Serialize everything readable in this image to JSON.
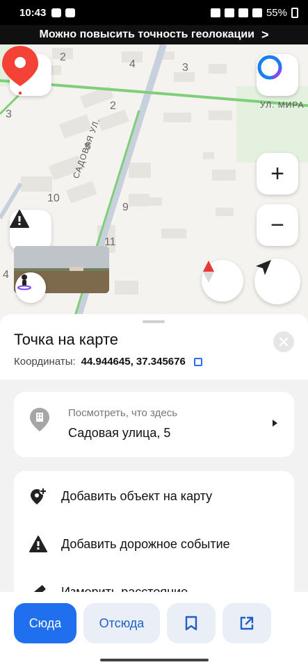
{
  "status_bar": {
    "time": "10:43",
    "battery": "55%"
  },
  "banner": {
    "text": "Можно повысить точность геолокации",
    "chevron": ">"
  },
  "map": {
    "house_numbers": [
      "2",
      "4",
      "3",
      "3",
      "2",
      "6",
      "10",
      "9",
      "11",
      "4"
    ],
    "street_sadovaya": "САДОВАЯ УЛ.",
    "street_mira": "УЛ. МИРА",
    "zoom_in_label": "+",
    "zoom_out_label": "−",
    "colors": {
      "pin": "#f44336",
      "road": "#c7d0dc",
      "green_road": "#7fcf7a",
      "compass_red": "#e53935"
    }
  },
  "sheet": {
    "title": "Точка на карте",
    "coords_label": "Координаты:",
    "coords_value": "44.944645, 37.345676",
    "what_here": {
      "subtitle": "Посмотреть, что здесь",
      "address": "Садовая улица, 5"
    },
    "actions": [
      {
        "label": "Добавить объект на карту",
        "icon": "add-place-icon"
      },
      {
        "label": "Добавить дорожное событие",
        "icon": "warning-icon"
      },
      {
        "label": "Измерить расстояние",
        "icon": "ruler-icon"
      }
    ]
  },
  "bottom_bar": {
    "here_label": "Сюда",
    "from_label": "Отсюда",
    "save_icon": "bookmark-icon",
    "share_icon": "share-icon",
    "accent": "#1f6fef"
  }
}
